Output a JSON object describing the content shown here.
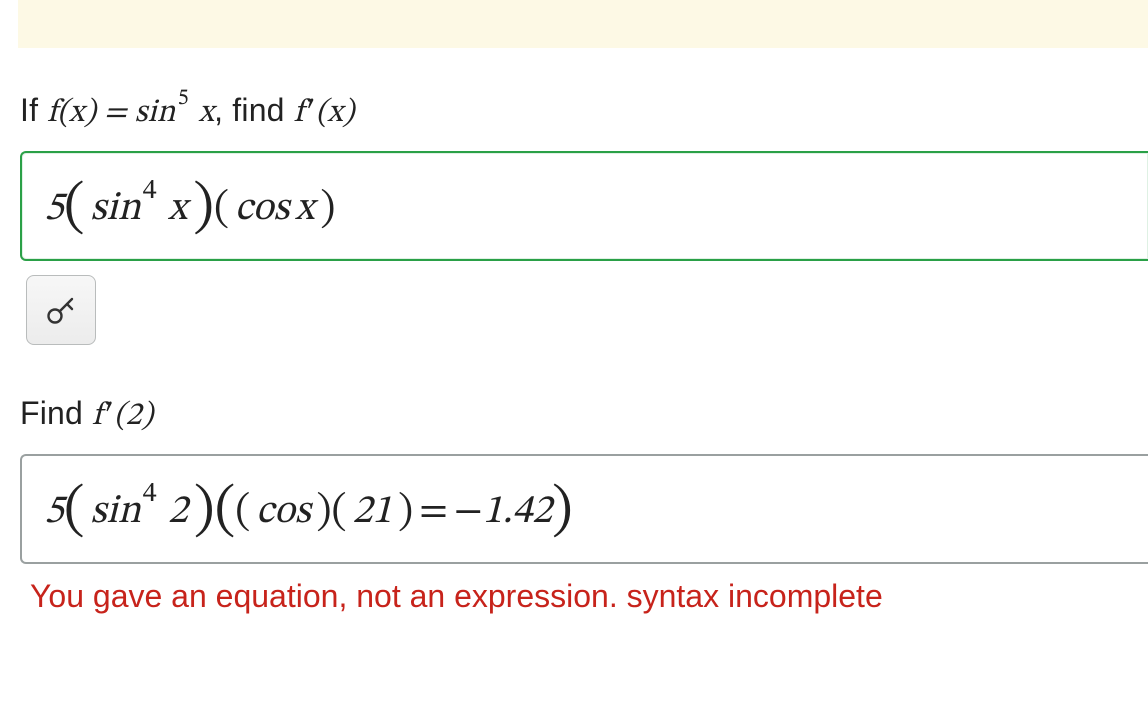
{
  "prompt1": {
    "prefix": "If ",
    "func_lhs_html": "f(x) = sin<span class='sup'>5</span> x",
    "mid": ", find ",
    "func_rhs_html": "f<span class='prime'>&#8202;&#x2032;</span>(x)"
  },
  "answer1": {
    "expr_html": "5<span class='big-paren'>(</span><span class='thin'></span>sin<span class='sup4'>4</span> x<span class='thin'></span><span class='big-paren'>)</span><span class='med-paren'>(</span><span class='thin'></span>cos<span class='thin'></span>x<span class='thin'></span><span class='med-paren'>)</span>"
  },
  "prompt2": {
    "prefix": "Find ",
    "func_html": "f<span class='prime'>&#8202;&#x2032;</span>(2)"
  },
  "answer2": {
    "expr_html": "5<span class='big-paren'>(</span><span class='thin'></span>sin<span class='sup4'>4</span> 2<span class='thin'></span><span class='big-paren'>)</span><span class='big-paren'>(</span><span class='med-paren'>(</span><span class='thin'></span>cos<span class='thin'></span><span class='med-paren'>)</span><span class='med-paren'>(</span><span class='thin'></span>21<span class='thin'></span><span class='med-paren'>)</span><span class='eq'>=</span><span class='minus'>&minus;</span>1.42<span class='big-paren'>)</span>"
  },
  "error": "You gave an equation, not an expression. syntax incomplete",
  "icons": {
    "key": "key-icon"
  }
}
